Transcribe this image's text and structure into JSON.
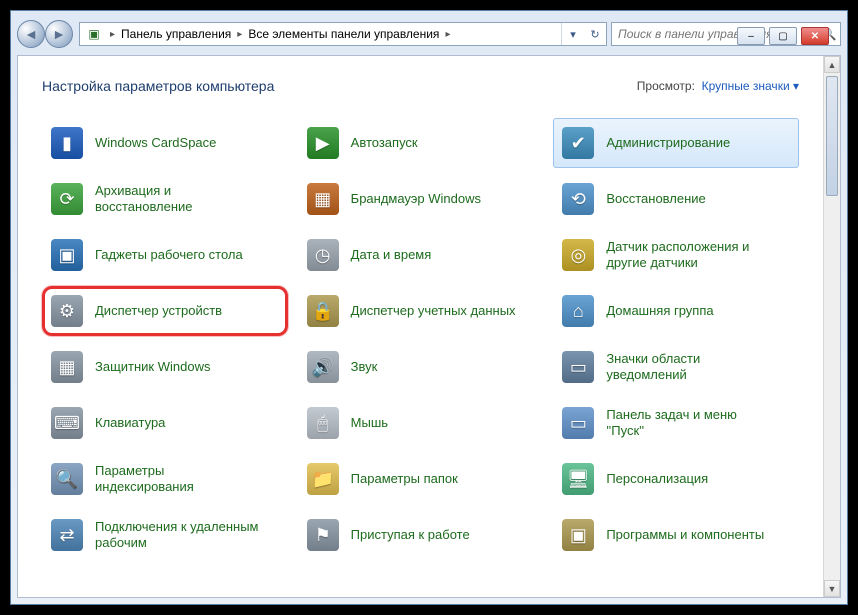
{
  "window_controls": {
    "min": "–",
    "max": "▢",
    "close": "✕"
  },
  "breadcrumbs": [
    "Панель управления",
    "Все элементы панели управления"
  ],
  "search": {
    "placeholder": "Поиск в панели управления"
  },
  "page_title": "Настройка параметров компьютера",
  "view_by_label": "Просмотр:",
  "view_by_value": "Крупные значки",
  "items": [
    {
      "label": "Windows CardSpace",
      "icon": "cardspace",
      "bg": "#3f76c9",
      "glyph": "▮",
      "highlighted": false,
      "selected": false
    },
    {
      "label": "Автозапуск",
      "icon": "autoplay",
      "bg": "#4aa34a",
      "glyph": "▶",
      "highlighted": false,
      "selected": false
    },
    {
      "label": "Администрирование",
      "icon": "admin-tools",
      "bg": "#5aa0c9",
      "glyph": "✔",
      "highlighted": false,
      "selected": true
    },
    {
      "label": "Архивация и восстановление",
      "icon": "backup",
      "bg": "#5ab35a",
      "glyph": "⟳",
      "highlighted": false,
      "selected": false
    },
    {
      "label": "Брандмауэр Windows",
      "icon": "firewall",
      "bg": "#c97a3f",
      "glyph": "▦",
      "highlighted": false,
      "selected": false
    },
    {
      "label": "Восстановление",
      "icon": "recovery",
      "bg": "#6aa4d4",
      "glyph": "⟲",
      "highlighted": false,
      "selected": false
    },
    {
      "label": "Гаджеты рабочего стола",
      "icon": "gadgets",
      "bg": "#4a88c4",
      "glyph": "▣",
      "highlighted": false,
      "selected": false
    },
    {
      "label": "Дата и время",
      "icon": "date-time",
      "bg": "#aab2bb",
      "glyph": "◷",
      "highlighted": false,
      "selected": false
    },
    {
      "label": "Датчик расположения и другие датчики",
      "icon": "sensors",
      "bg": "#d4b94a",
      "glyph": "◎",
      "highlighted": false,
      "selected": false
    },
    {
      "label": "Диспетчер устройств",
      "icon": "device-manager",
      "bg": "#9aa6b2",
      "glyph": "⚙",
      "highlighted": true,
      "selected": false
    },
    {
      "label": "Диспетчер учетных данных",
      "icon": "credential-mgr",
      "bg": "#b9a96a",
      "glyph": "🔒",
      "highlighted": false,
      "selected": false
    },
    {
      "label": "Домашняя группа",
      "icon": "homegroup",
      "bg": "#6aa4d4",
      "glyph": "⌂",
      "highlighted": false,
      "selected": false
    },
    {
      "label": "Защитник Windows",
      "icon": "defender",
      "bg": "#9aa6b2",
      "glyph": "▦",
      "highlighted": false,
      "selected": false
    },
    {
      "label": "Звук",
      "icon": "sound",
      "bg": "#b0b8c2",
      "glyph": "🔊",
      "highlighted": false,
      "selected": false
    },
    {
      "label": "Значки области уведомлений",
      "icon": "notification",
      "bg": "#7a94b0",
      "glyph": "▭",
      "highlighted": false,
      "selected": false
    },
    {
      "label": "Клавиатура",
      "icon": "keyboard",
      "bg": "#9aa6b2",
      "glyph": "⌨",
      "highlighted": false,
      "selected": false
    },
    {
      "label": "Мышь",
      "icon": "mouse",
      "bg": "#c4cad2",
      "glyph": "🖱",
      "highlighted": false,
      "selected": false
    },
    {
      "label": "Панель задач и меню ''Пуск''",
      "icon": "taskbar",
      "bg": "#7aa4d4",
      "glyph": "▭",
      "highlighted": false,
      "selected": false
    },
    {
      "label": "Параметры индексирования",
      "icon": "indexing",
      "bg": "#8aa6c4",
      "glyph": "🔍",
      "highlighted": false,
      "selected": false
    },
    {
      "label": "Параметры папок",
      "icon": "folder-opts",
      "bg": "#e6c96a",
      "glyph": "📁",
      "highlighted": false,
      "selected": false
    },
    {
      "label": "Персонализация",
      "icon": "personalize",
      "bg": "#6ac49a",
      "glyph": "🖥",
      "highlighted": false,
      "selected": false
    },
    {
      "label": "Подключения к удаленным рабочим",
      "icon": "remote",
      "bg": "#6a9ac4",
      "glyph": "⇄",
      "highlighted": false,
      "selected": false
    },
    {
      "label": "Приступая к работе",
      "icon": "getting-started",
      "bg": "#9aa6b2",
      "glyph": "⚑",
      "highlighted": false,
      "selected": false
    },
    {
      "label": "Программы и компоненты",
      "icon": "programs",
      "bg": "#b9a96a",
      "glyph": "▣",
      "highlighted": false,
      "selected": false
    }
  ]
}
